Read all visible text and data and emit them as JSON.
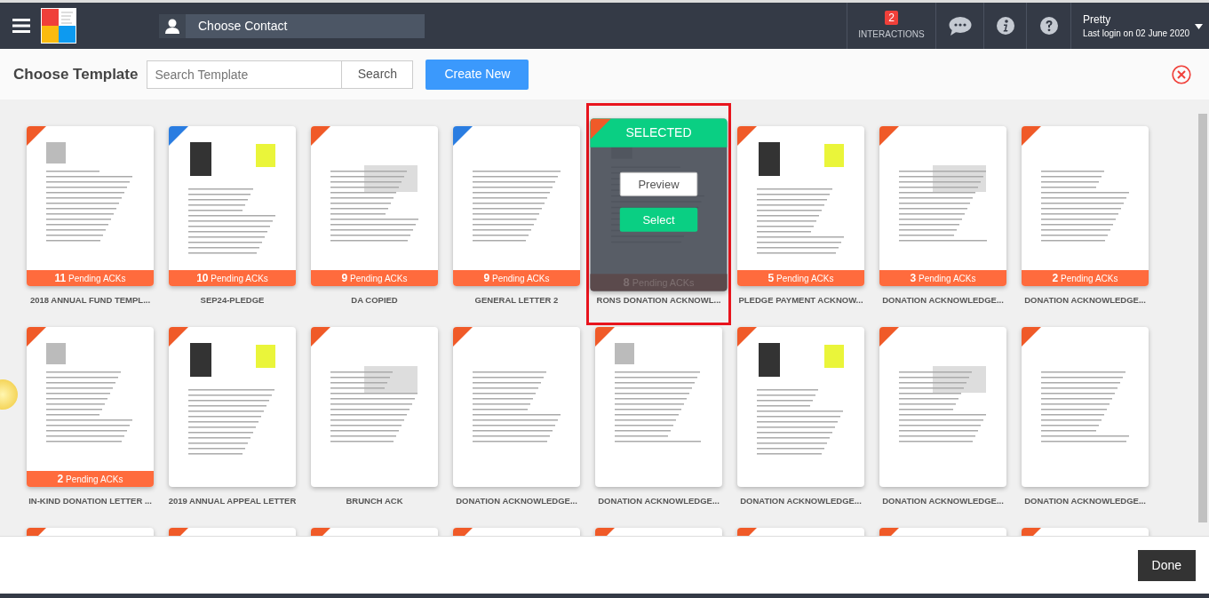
{
  "navbar": {
    "contact_placeholder": "Choose Contact",
    "interactions": {
      "count": "2",
      "label": "INTERACTIONS"
    },
    "user": {
      "name": "Pretty",
      "last_login": "Last login on 02 June 2020"
    }
  },
  "header": {
    "title": "Choose Template",
    "search": {
      "placeholder": "Search Template",
      "button": "Search"
    },
    "create_button": "Create New"
  },
  "selected_overlay": {
    "banner": "SELECTED",
    "preview_button": "Preview",
    "select_button": "Select"
  },
  "templates": [
    {
      "name": "2018 ANNUAL FUND TEMPL...",
      "pending_count": "11",
      "pending_label": "Pending ACKs",
      "color": "#f05a28",
      "selected": false
    },
    {
      "name": "SEP24-PLEDGE",
      "pending_count": "10",
      "pending_label": "Pending ACKs",
      "color": "#2a7de1",
      "selected": false
    },
    {
      "name": "DA COPIED",
      "pending_count": "9",
      "pending_label": "Pending ACKs",
      "color": "#f05a28",
      "selected": false
    },
    {
      "name": "GENERAL LETTER 2",
      "pending_count": "9",
      "pending_label": "Pending ACKs",
      "color": "#2a7de1",
      "selected": false
    },
    {
      "name": "RONS DONATION ACKNOWL...",
      "pending_count": "8",
      "pending_label": "Pending ACKs",
      "color": "#f05a28",
      "selected": true
    },
    {
      "name": "PLEDGE PAYMENT ACKNOW...",
      "pending_count": "5",
      "pending_label": "Pending ACKs",
      "color": "#f05a28",
      "selected": false
    },
    {
      "name": "DONATION ACKNOWLEDGE...",
      "pending_count": "3",
      "pending_label": "Pending ACKs",
      "color": "#f05a28",
      "selected": false
    },
    {
      "name": "DONATION ACKNOWLEDGE...",
      "pending_count": "2",
      "pending_label": "Pending ACKs",
      "color": "#f05a28",
      "selected": false
    },
    {
      "name": "IN-KIND DONATION LETTER ...",
      "pending_count": "2",
      "pending_label": "Pending ACKs",
      "color": "#f05a28",
      "selected": false
    },
    {
      "name": "2019 ANNUAL APPEAL LETTER",
      "color": "#f05a28",
      "selected": false
    },
    {
      "name": "BRUNCH ACK",
      "color": "#f05a28",
      "selected": false
    },
    {
      "name": "DONATION ACKNOWLEDGE...",
      "color": "#f05a28",
      "selected": false
    },
    {
      "name": "DONATION ACKNOWLEDGE...",
      "color": "#f05a28",
      "selected": false
    },
    {
      "name": "DONATION ACKNOWLEDGE...",
      "color": "#f05a28",
      "selected": false
    },
    {
      "name": "DONATION ACKNOWLEDGE...",
      "color": "#f05a28",
      "selected": false
    },
    {
      "name": "DONATION ACKNOWLEDGE...",
      "color": "#f05a28",
      "selected": false
    },
    {
      "color": "#f05a28",
      "selected": false
    },
    {
      "color": "#f05a28",
      "selected": false
    },
    {
      "color": "#f05a28",
      "selected": false
    },
    {
      "color": "#f05a28",
      "selected": false
    },
    {
      "color": "#f05a28",
      "selected": false
    },
    {
      "color": "#f05a28",
      "selected": false
    },
    {
      "color": "#f05a28",
      "selected": false
    },
    {
      "color": "#f05a28",
      "selected": false
    }
  ],
  "footer": {
    "done_button": "Done"
  }
}
